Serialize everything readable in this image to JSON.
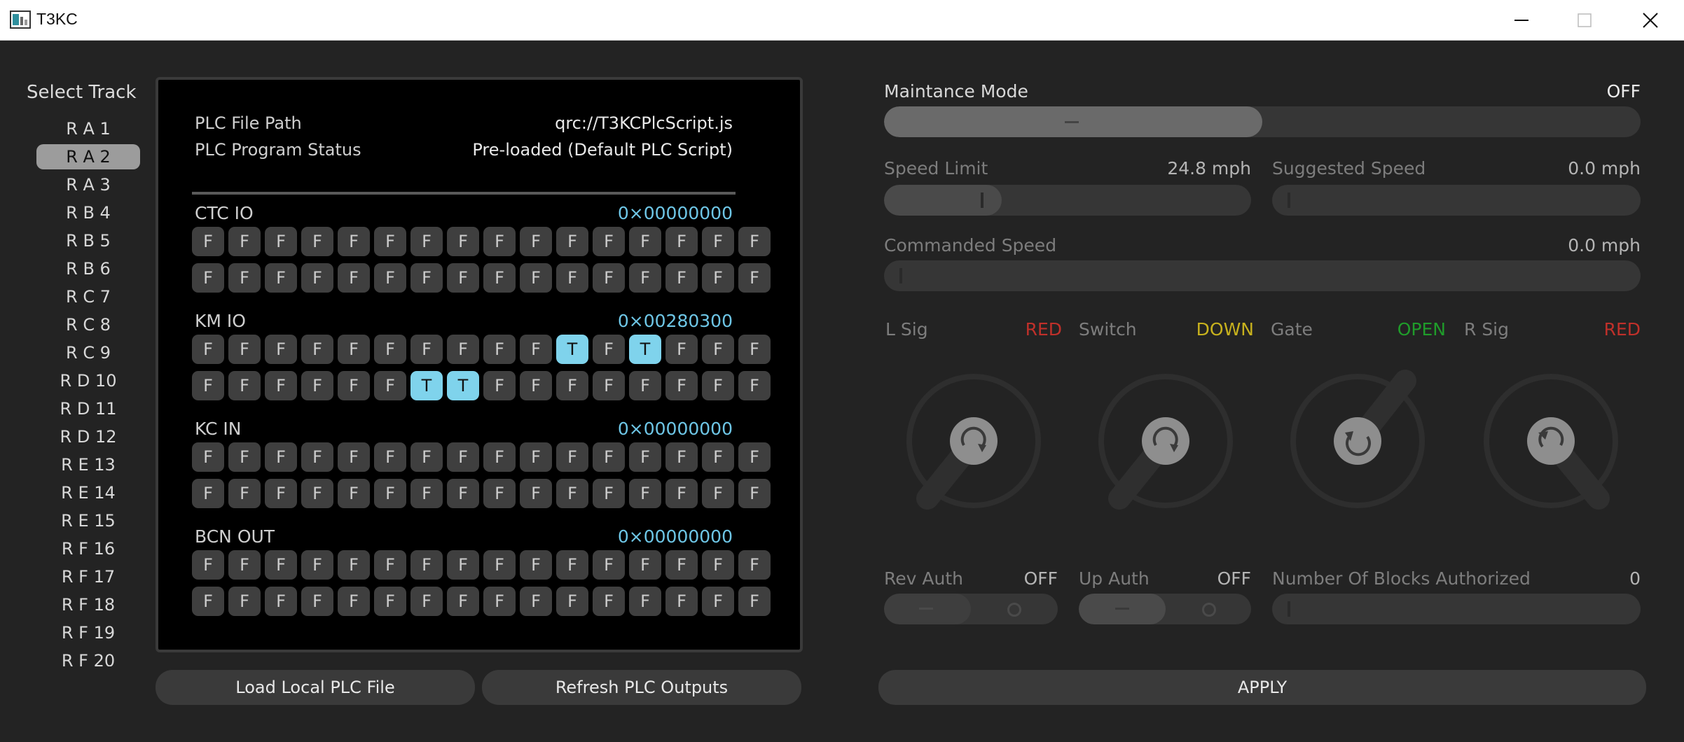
{
  "window": {
    "title": "T3KC"
  },
  "sidebar": {
    "heading": "Select Track",
    "tracks": [
      "R A 1",
      "R A 2",
      "R A 3",
      "R B 4",
      "R B 5",
      "R B 6",
      "R C 7",
      "R C 8",
      "R C 9",
      "R D 10",
      "R D 11",
      "R D 12",
      "R E 13",
      "R E 14",
      "R E 15",
      "R F 16",
      "R F 17",
      "R F 18",
      "R F 19",
      "R F 20"
    ],
    "selected_index": 1
  },
  "plc": {
    "file_path_label": "PLC File Path",
    "file_path_value": "qrc://T3KCPlcScript.js",
    "status_label": "PLC Program Status",
    "status_value": "Pre-loaded (Default PLC Script)",
    "sections": [
      {
        "name": "CTC IO",
        "hex": "0×00000000",
        "rows": [
          [
            "F",
            "F",
            "F",
            "F",
            "F",
            "F",
            "F",
            "F",
            "F",
            "F",
            "F",
            "F",
            "F",
            "F",
            "F",
            "F"
          ],
          [
            "F",
            "F",
            "F",
            "F",
            "F",
            "F",
            "F",
            "F",
            "F",
            "F",
            "F",
            "F",
            "F",
            "F",
            "F",
            "F"
          ]
        ]
      },
      {
        "name": "KM IO",
        "hex": "0×00280300",
        "rows": [
          [
            "F",
            "F",
            "F",
            "F",
            "F",
            "F",
            "F",
            "F",
            "F",
            "F",
            "T",
            "F",
            "T",
            "F",
            "F",
            "F"
          ],
          [
            "F",
            "F",
            "F",
            "F",
            "F",
            "F",
            "T",
            "T",
            "F",
            "F",
            "F",
            "F",
            "F",
            "F",
            "F",
            "F"
          ]
        ]
      },
      {
        "name": "KC IN",
        "hex": "0×00000000",
        "rows": [
          [
            "F",
            "F",
            "F",
            "F",
            "F",
            "F",
            "F",
            "F",
            "F",
            "F",
            "F",
            "F",
            "F",
            "F",
            "F",
            "F"
          ],
          [
            "F",
            "F",
            "F",
            "F",
            "F",
            "F",
            "F",
            "F",
            "F",
            "F",
            "F",
            "F",
            "F",
            "F",
            "F",
            "F"
          ]
        ]
      },
      {
        "name": "BCN OUT",
        "hex": "0×00000000",
        "rows": [
          [
            "F",
            "F",
            "F",
            "F",
            "F",
            "F",
            "F",
            "F",
            "F",
            "F",
            "F",
            "F",
            "F",
            "F",
            "F",
            "F"
          ],
          [
            "F",
            "F",
            "F",
            "F",
            "F",
            "F",
            "F",
            "F",
            "F",
            "F",
            "F",
            "F",
            "F",
            "F",
            "F",
            "F"
          ]
        ]
      }
    ],
    "load_button": "Load Local PLC File",
    "refresh_button": "Refresh PLC Outputs"
  },
  "controls": {
    "maintenance_label": "Maintance Mode",
    "maintenance_value": "OFF",
    "maintenance_level": 0.5,
    "speed_limit_label": "Speed Limit",
    "speed_limit_value": "24.8 mph",
    "speed_limit_level": 0.32,
    "suggested_speed_label": "Suggested Speed",
    "suggested_speed_value": "0.0 mph",
    "commanded_speed_label": "Commanded Speed",
    "commanded_speed_value": "0.0 mph",
    "l_sig_label": "L Sig",
    "l_sig_value": "RED",
    "switch_label": "Switch",
    "switch_value": "DOWN",
    "gate_label": "Gate",
    "gate_value": "OPEN",
    "r_sig_label": "R Sig",
    "r_sig_value": "RED",
    "rev_auth_label": "Rev Auth",
    "rev_auth_value": "OFF",
    "up_auth_label": "Up Auth",
    "up_auth_value": "OFF",
    "blocks_label": "Number Of Blocks Authorized",
    "blocks_value": "0",
    "apply_button": "APPLY"
  },
  "colors": {
    "red": "#c0302a",
    "yellow": "#c8b21d",
    "green": "#1f9c2a",
    "accent": "#7fd3ec"
  }
}
